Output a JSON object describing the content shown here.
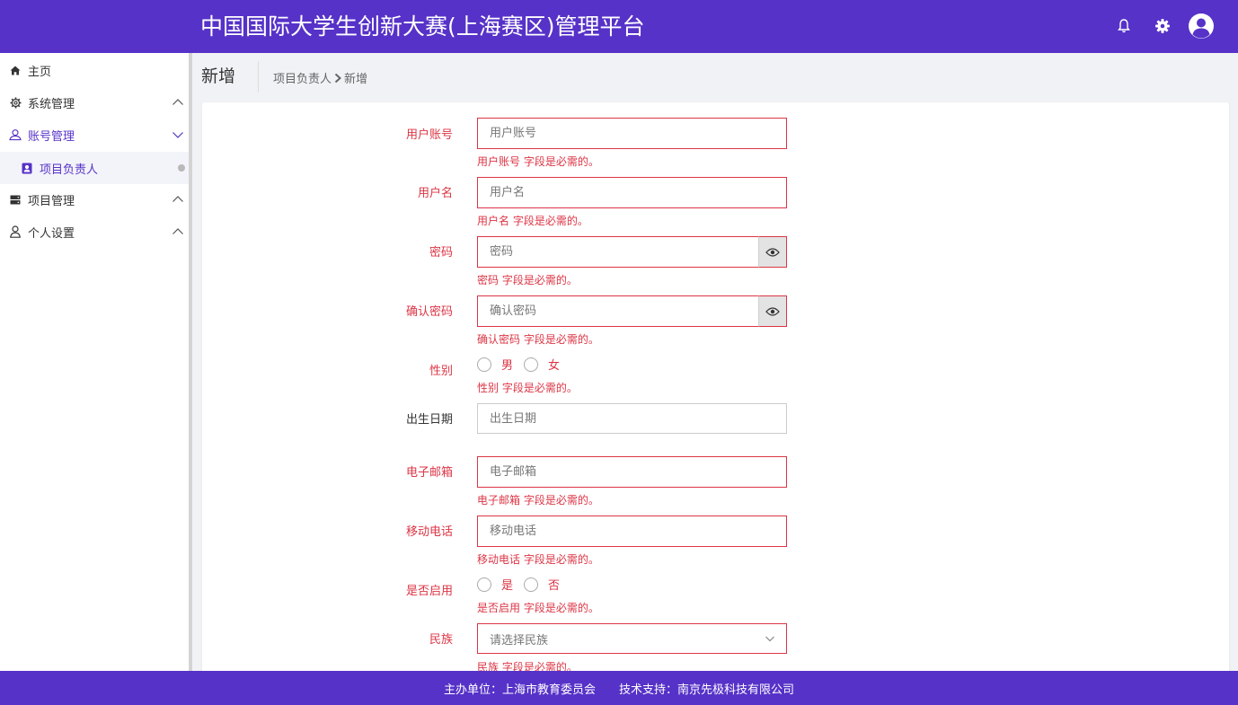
{
  "header": {
    "title": "中国国际大学生创新大赛(上海赛区)管理平台",
    "icons": [
      "bell-icon",
      "gear-icon",
      "user-avatar-icon"
    ]
  },
  "sidebar": {
    "items": [
      {
        "label": "主页",
        "icon": "home-icon"
      },
      {
        "label": "系统管理",
        "icon": "gear-icon",
        "expanded": false
      },
      {
        "label": "账号管理",
        "icon": "account-icon",
        "expanded": true,
        "active": true
      },
      {
        "label": "项目管理",
        "icon": "server-icon",
        "expanded": false
      },
      {
        "label": "个人设置",
        "icon": "user-icon",
        "expanded": false
      }
    ],
    "sub_items": [
      {
        "label": "项目负责人",
        "icon": "contact-card-icon"
      }
    ]
  },
  "page": {
    "title": "新增",
    "breadcrumb": [
      "项目负责人",
      "新增"
    ]
  },
  "form": {
    "username": {
      "label": "用户账号",
      "placeholder": "用户账号",
      "error": "用户账号 字段是必需的。"
    },
    "name": {
      "label": "用户名",
      "placeholder": "用户名",
      "error": "用户名 字段是必需的。"
    },
    "password": {
      "label": "密码",
      "placeholder": "密码",
      "error": "密码 字段是必需的。"
    },
    "confirm_password": {
      "label": "确认密码",
      "placeholder": "确认密码",
      "error": "确认密码 字段是必需的。"
    },
    "gender": {
      "label": "性别",
      "options": [
        "男",
        "女"
      ],
      "error": "性别 字段是必需的。"
    },
    "birthday": {
      "label": "出生日期",
      "placeholder": "出生日期"
    },
    "email": {
      "label": "电子邮箱",
      "placeholder": "电子邮箱",
      "error": "电子邮箱 字段是必需的。"
    },
    "mobile": {
      "label": "移动电话",
      "placeholder": "移动电话",
      "error": "移动电话 字段是必需的。"
    },
    "enabled": {
      "label": "是否启用",
      "options": [
        "是",
        "否"
      ],
      "error": "是否启用 字段是必需的。"
    },
    "ethnicity": {
      "label": "民族",
      "placeholder": "请选择民族",
      "error": "民族 字段是必需的。"
    }
  },
  "footer": {
    "host": "主办单位：上海市教育委员会",
    "support": "技术支持：南京先极科技有限公司"
  },
  "colors": {
    "brand": "#5632c8",
    "error": "#dc3545"
  }
}
